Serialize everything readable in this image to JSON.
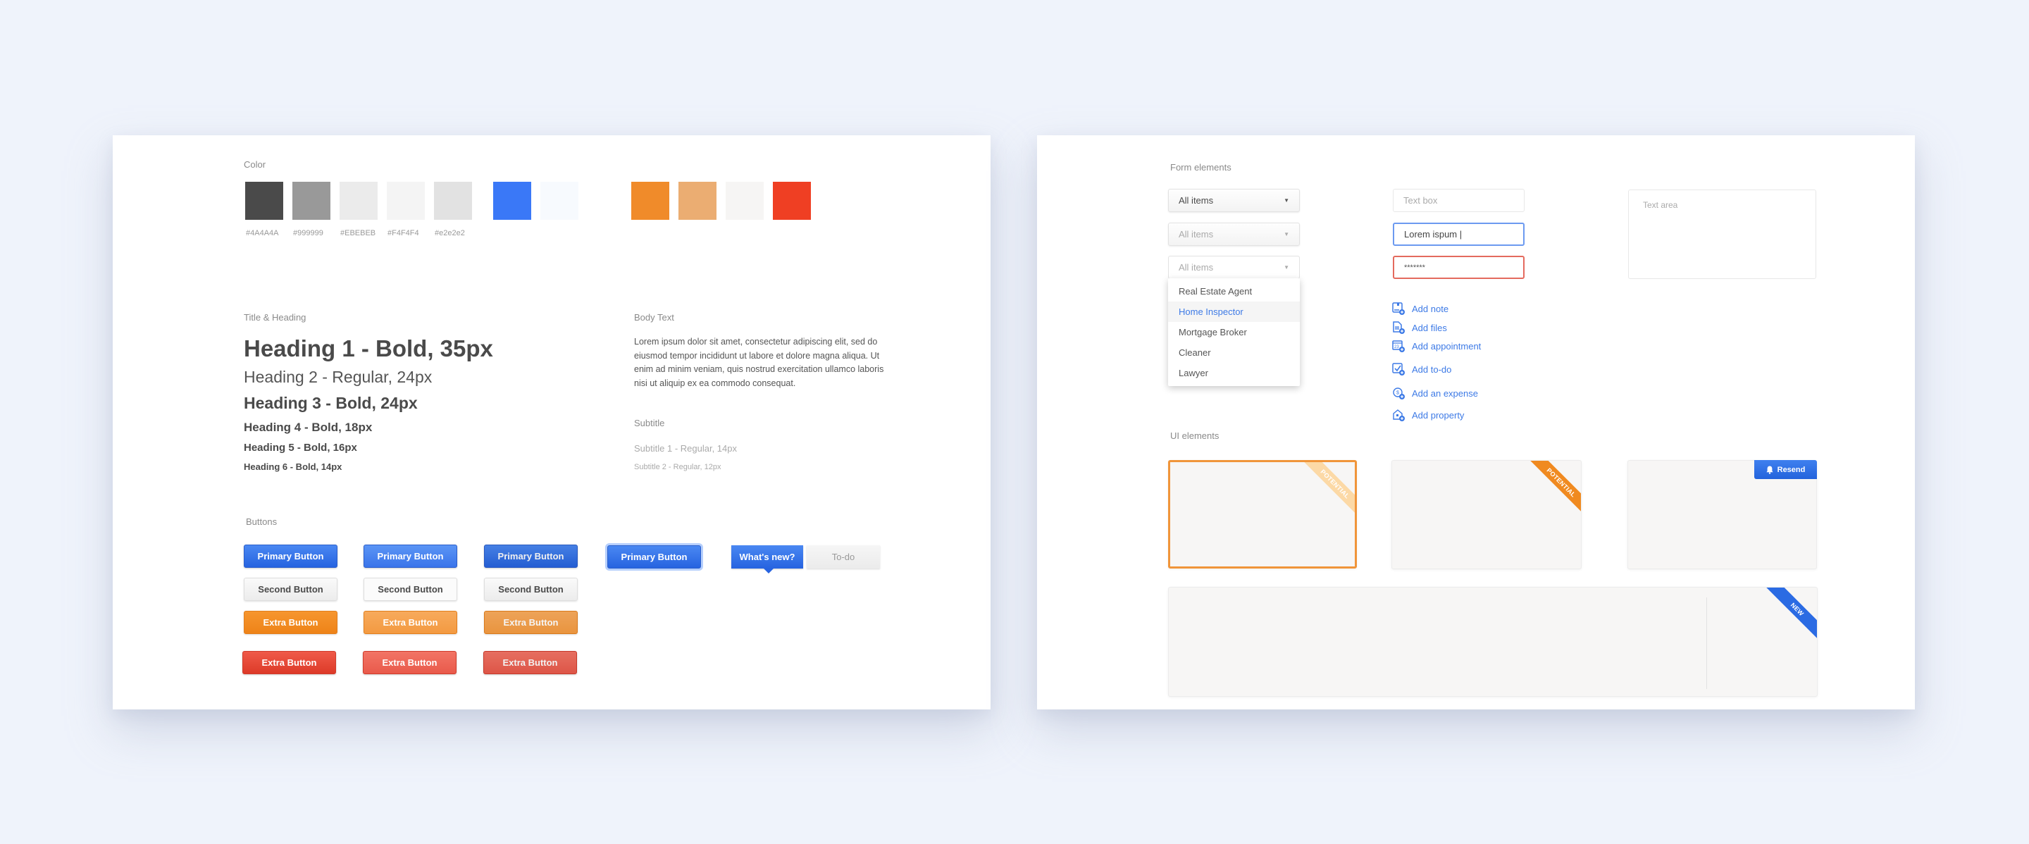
{
  "left_panel": {
    "color": {
      "label": "Color",
      "swatches": [
        {
          "hex": "#4A4A4A",
          "label": "#4A4A4A"
        },
        {
          "hex": "#999999",
          "label": "#999999"
        },
        {
          "hex": "#EBEBEB",
          "label": "#EBEBEB"
        },
        {
          "hex": "#F4F4F4",
          "label": "#F4F4F4"
        },
        {
          "hex": "#e2e2e2",
          "label": "#e2e2e2"
        },
        {
          "hex": "#3A78F7",
          "label": ""
        },
        {
          "hex": "#F7FAFE",
          "label": ""
        },
        {
          "hex": "#F08B2A",
          "label": ""
        },
        {
          "hex": "#EBAD72",
          "label": ""
        },
        {
          "hex": "#F6F5F4",
          "label": ""
        },
        {
          "hex": "#EF3F23",
          "label": ""
        }
      ]
    },
    "headings": {
      "label": "Title & Heading",
      "h1": "Heading 1 - Bold, 35px",
      "h2": "Heading 2 - Regular, 24px",
      "h3": "Heading 3 - Bold, 24px",
      "h4": "Heading 4 - Bold, 18px",
      "h5": "Heading 5 - Bold, 16px",
      "h6": "Heading 6 - Bold, 14px"
    },
    "body_text": {
      "label": "Body Text",
      "paragraph": "Lorem ipsum dolor sit amet, consectetur adipiscing elit, sed do eiusmod tempor incididunt ut labore et dolore magna aliqua. Ut enim ad minim veniam, quis nostrud exercitation ullamco laboris nisi ut aliquip ex ea commodo consequat.",
      "subtitle_label": "Subtitle",
      "subtitle1": "Subtitle 1 - Regular, 14px",
      "subtitle2": "Subtitle 2 - Regular, 12px"
    },
    "buttons": {
      "label": "Buttons",
      "primary": "Primary Button",
      "second": "Second Button",
      "extra": "Extra Button",
      "whats_new": "What's new?",
      "todo": "To-do"
    }
  },
  "right_panel": {
    "form": {
      "label": "Form elements",
      "select_value": "All items",
      "dropdown_options": [
        "Real Estate Agent",
        "Home Inspector",
        "Mortgage Broker",
        "Cleaner",
        "Lawyer"
      ],
      "dropdown_active_index": 1,
      "textbox_placeholder": "Text box",
      "textbox_focused_value": "Lorem ispum |",
      "password_value": "*******",
      "textarea_placeholder": "Text area",
      "actions": [
        {
          "label": "Add note",
          "icon": "note-add-icon"
        },
        {
          "label": "Add files",
          "icon": "file-add-icon"
        },
        {
          "label": "Add appointment",
          "icon": "calendar-add-icon"
        },
        {
          "label": "Add to-do",
          "icon": "todo-add-icon"
        },
        {
          "label": "Add an expense",
          "icon": "expense-add-icon"
        },
        {
          "label": "Add property",
          "icon": "property-add-icon"
        }
      ]
    },
    "ui": {
      "label": "UI elements",
      "ribbon_potential": "POTENTIAL",
      "ribbon_new": "NEW",
      "resend_label": "Resend"
    }
  },
  "colors": {
    "accent_blue": "#3d7ae6",
    "accent_orange": "#f08a20",
    "error_red": "#e46a5e"
  }
}
